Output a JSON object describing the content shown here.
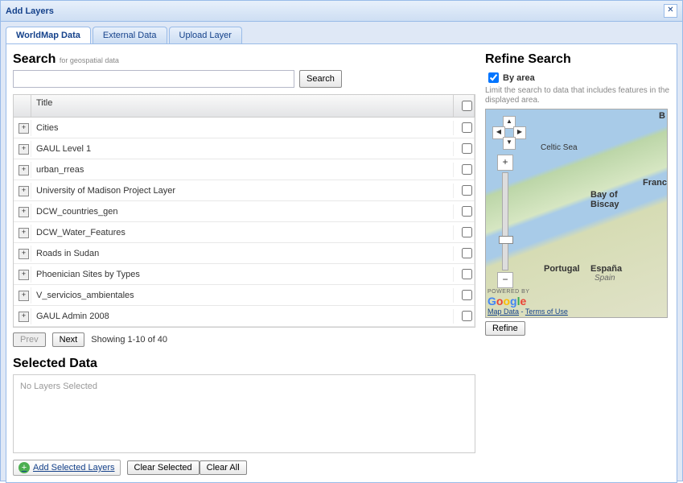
{
  "window": {
    "title": "Add Layers",
    "close_aria": "Close"
  },
  "tabs": [
    {
      "label": "WorldMap Data",
      "active": true
    },
    {
      "label": "External Data",
      "active": false
    },
    {
      "label": "Upload Layer",
      "active": false
    }
  ],
  "search": {
    "heading": "Search",
    "sub": "for geospatial data",
    "value": "",
    "placeholder": "",
    "button": "Search"
  },
  "grid": {
    "header_title": "Title",
    "rows": [
      {
        "title": "Cities"
      },
      {
        "title": "GAUL Level 1"
      },
      {
        "title": "urban_rreas"
      },
      {
        "title": "University of Madison Project Layer"
      },
      {
        "title": "DCW_countries_gen"
      },
      {
        "title": "DCW_Water_Features"
      },
      {
        "title": "Roads in Sudan"
      },
      {
        "title": "Phoenician Sites by Types"
      },
      {
        "title": "V_servicios_ambientales"
      },
      {
        "title": "GAUL Admin 2008"
      }
    ]
  },
  "pager": {
    "prev": "Prev",
    "next": "Next",
    "status": "Showing 1-10 of 40"
  },
  "selected": {
    "heading": "Selected Data",
    "empty": "No Layers Selected"
  },
  "actions": {
    "add": "Add Selected Layers",
    "clear_selected": "Clear Selected",
    "clear_all": "Clear All"
  },
  "refine": {
    "heading": "Refine Search",
    "checkbox_label": "By area",
    "checkbox_checked": true,
    "desc": "Limit the search to data that includes features in the displayed area.",
    "button": "Refine"
  },
  "map": {
    "labels": {
      "celtic_sea": "Celtic Sea",
      "bay_of_biscay": "Bay of\nBiscay",
      "france": "Franc",
      "portugal": "Portugal",
      "espana": "España",
      "spain": "Spain",
      "b": "B"
    },
    "zoom": {
      "plus": "+",
      "minus": "−"
    },
    "footer": {
      "powered": "POWERED BY",
      "map_data": "Map Data",
      "terms": "Terms of Use"
    }
  }
}
